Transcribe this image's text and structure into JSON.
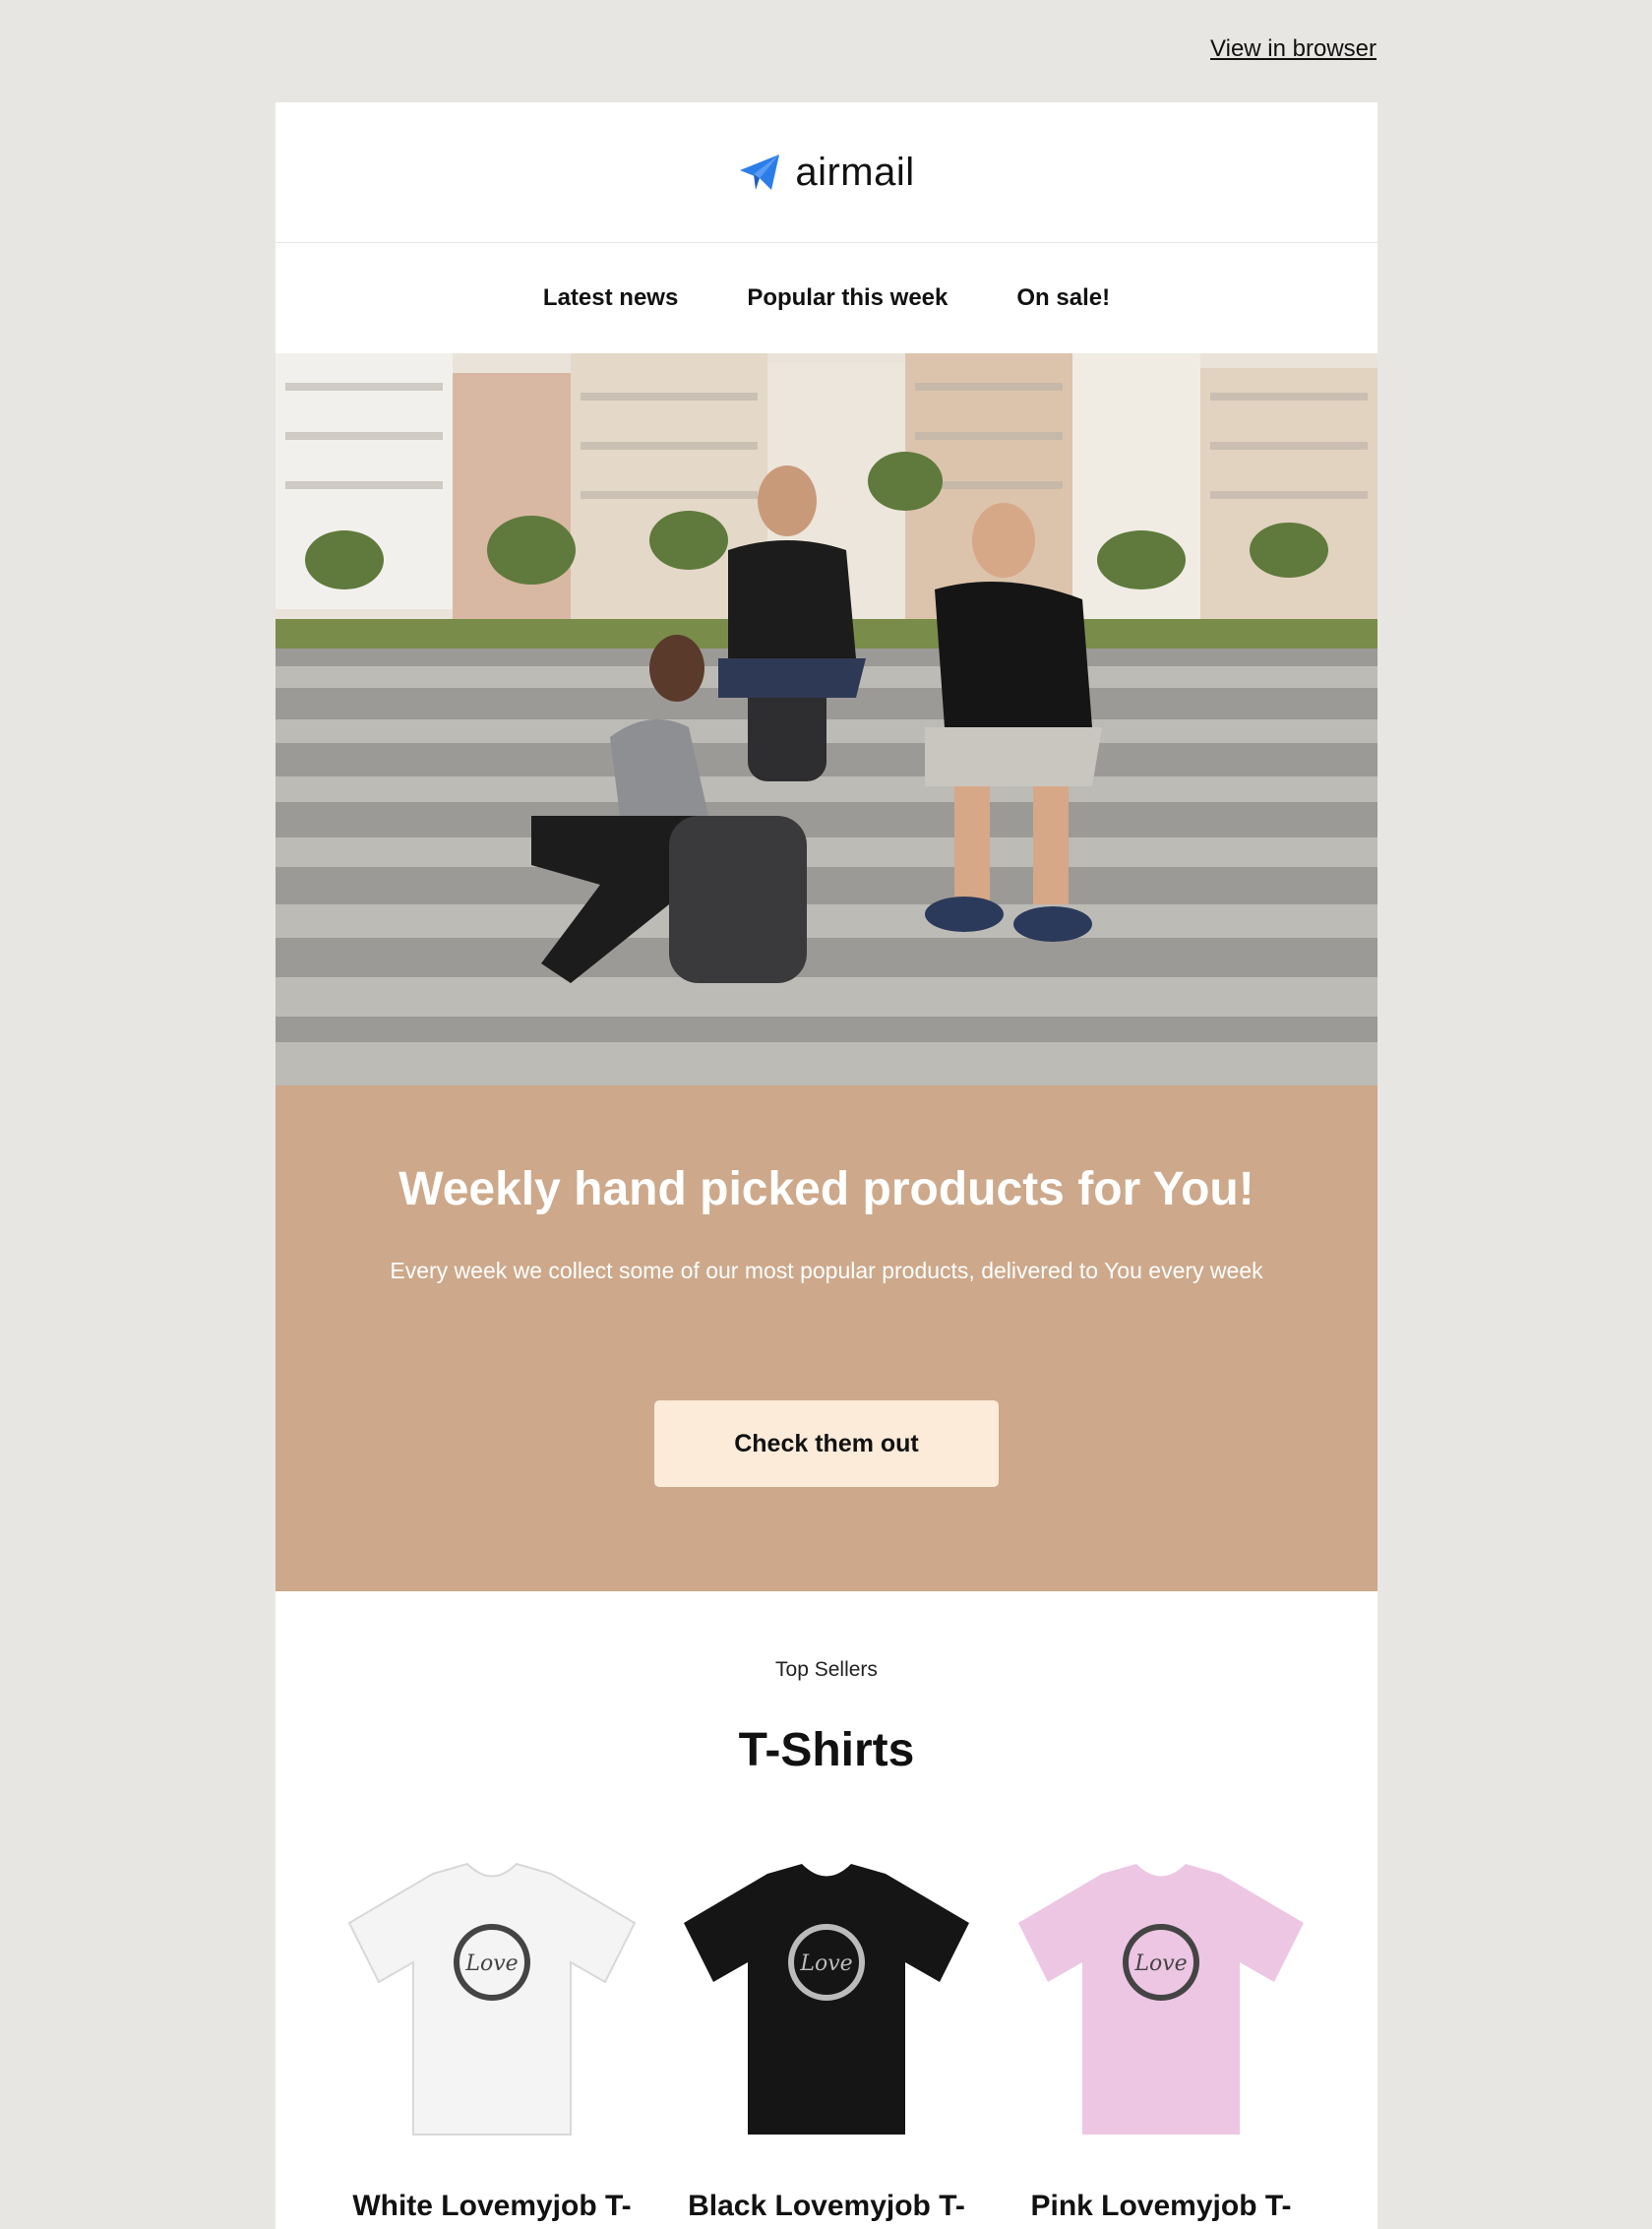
{
  "top": {
    "view_in_browser": "View in browser"
  },
  "header": {
    "logo_text": "airmail",
    "logo_icon": "paper-plane-icon",
    "accent": "#2b7de9"
  },
  "nav": {
    "items": [
      {
        "label": "Latest news"
      },
      {
        "label": "Popular this week"
      },
      {
        "label": "On sale!"
      }
    ]
  },
  "hero": {
    "image": "group-of-three-on-stone-steps"
  },
  "banner": {
    "title": "Weekly hand picked products for You!",
    "subtitle": "Every week we collect some of our most popular products, delivered to  You every week",
    "cta_label": "Check them out",
    "bg": "#cda88a",
    "cta_bg": "#fbebd8"
  },
  "sellers": {
    "eyebrow": "Top Sellers",
    "title": "T-Shirts",
    "products": [
      {
        "title": "White Lovemyjob T-",
        "color": "#f4f4f4",
        "print": "#444444"
      },
      {
        "title": "Black Lovemyjob T-",
        "color": "#151515",
        "print": "#bbbbbb"
      },
      {
        "title": "Pink Lovemyjob T-",
        "color": "#ecc6e3",
        "print": "#444444"
      }
    ]
  }
}
